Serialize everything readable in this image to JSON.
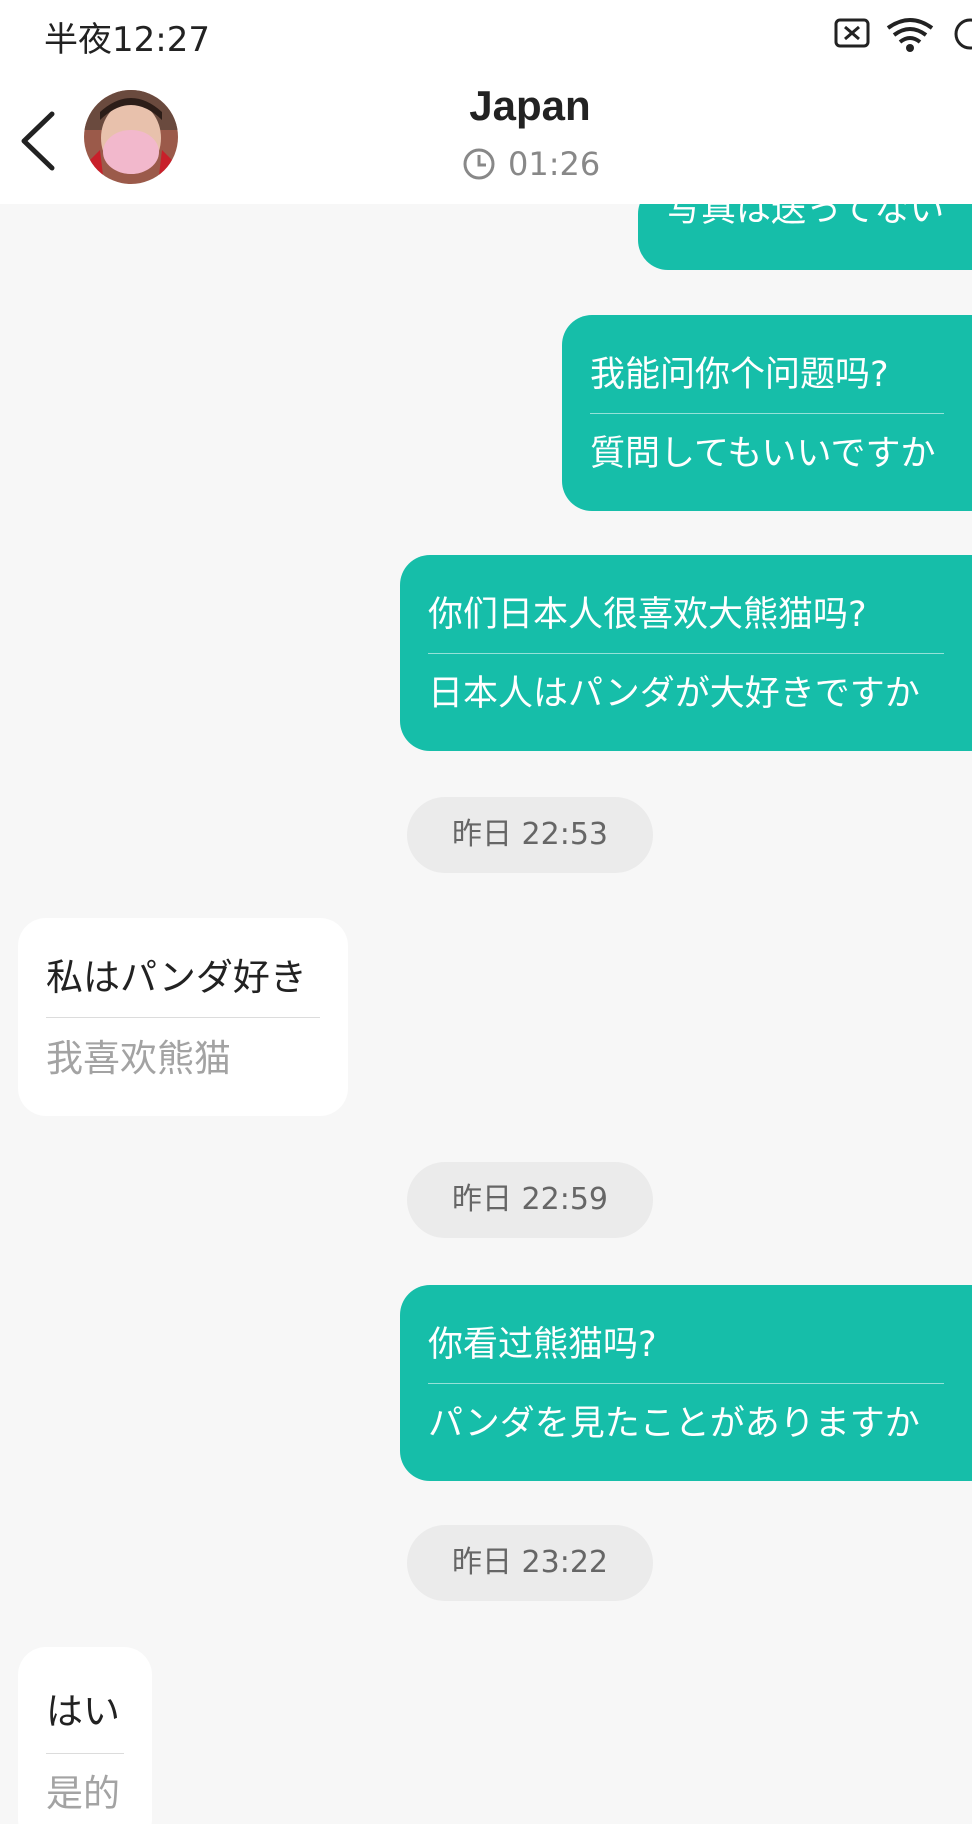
{
  "status_bar": {
    "time": "半夜12:27"
  },
  "header": {
    "contact_name": "Japan",
    "local_time": "01:26"
  },
  "icons": {
    "back": "chevron-left-icon",
    "clock": "clock-icon",
    "sim": "no-sim-icon",
    "wifi": "wifi-icon",
    "battery": "battery-icon"
  },
  "colors": {
    "outgoing_bubble": "#16bea9",
    "incoming_bubble": "#ffffff",
    "background": "#f7f7f7",
    "timestamp_pill": "#ebebeb"
  },
  "messages": {
    "m0": {
      "line": "写真は送ってない"
    },
    "m1": {
      "original": "我能问你个问题吗?",
      "translation": "質問してもいいですか"
    },
    "m2": {
      "original": "你们日本人很喜欢大熊猫吗?",
      "translation": "日本人はパンダが大好きですか"
    },
    "t1": "昨日 22:53",
    "m3": {
      "original": "私はパンダ好き",
      "translation": "我喜欢熊猫"
    },
    "t2": "昨日 22:59",
    "m4": {
      "original": "你看过熊猫吗?",
      "translation": "パンダを見たことがありますか"
    },
    "t3": "昨日 23:22",
    "m5": {
      "original": "はい",
      "translation": "是的"
    }
  }
}
